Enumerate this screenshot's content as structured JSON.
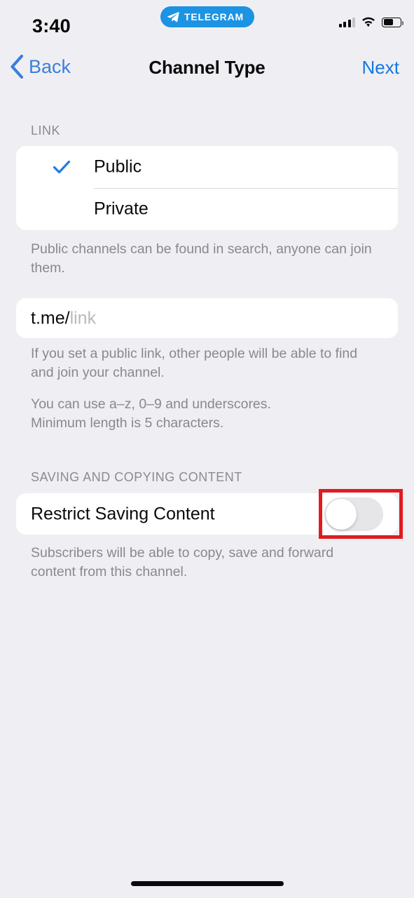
{
  "status_bar": {
    "time": "3:40",
    "app_badge": "TELEGRAM",
    "icons": {
      "signal": "signal-bars-icon",
      "wifi": "wifi-icon",
      "battery": "battery-icon"
    },
    "battery_level_percent": 50
  },
  "nav": {
    "back_label": "Back",
    "title": "Channel Type",
    "next_label": "Next",
    "accent_color": "#1578E0"
  },
  "link_section": {
    "header": "LINK",
    "options": [
      {
        "label": "Public",
        "selected": true
      },
      {
        "label": "Private",
        "selected": false
      }
    ],
    "footnote": "Public channels can be found in search, anyone can join them.",
    "input": {
      "prefix": "t.me/",
      "value": "",
      "placeholder": "link"
    },
    "input_footnote_1": "If you set a public link, other people will be able to find and join your channel.",
    "input_footnote_2_line1": "You can use a–z, 0–9 and underscores.",
    "input_footnote_2_line2": "Minimum length is 5 characters."
  },
  "saving_section": {
    "header": "SAVING AND COPYING CONTENT",
    "row_label": "Restrict Saving Content",
    "toggle_on": false,
    "footnote": "Subscribers will be able to copy, save and forward content from this channel."
  },
  "highlight": {
    "color": "#E01B20"
  },
  "colors": {
    "background": "#EFEFF3",
    "card": "#FFFFFF",
    "accent_blue": "#1578E0",
    "check_blue": "#1E7CE8",
    "muted_text": "#88888E",
    "toggle_off_track": "#E6E6E9"
  }
}
